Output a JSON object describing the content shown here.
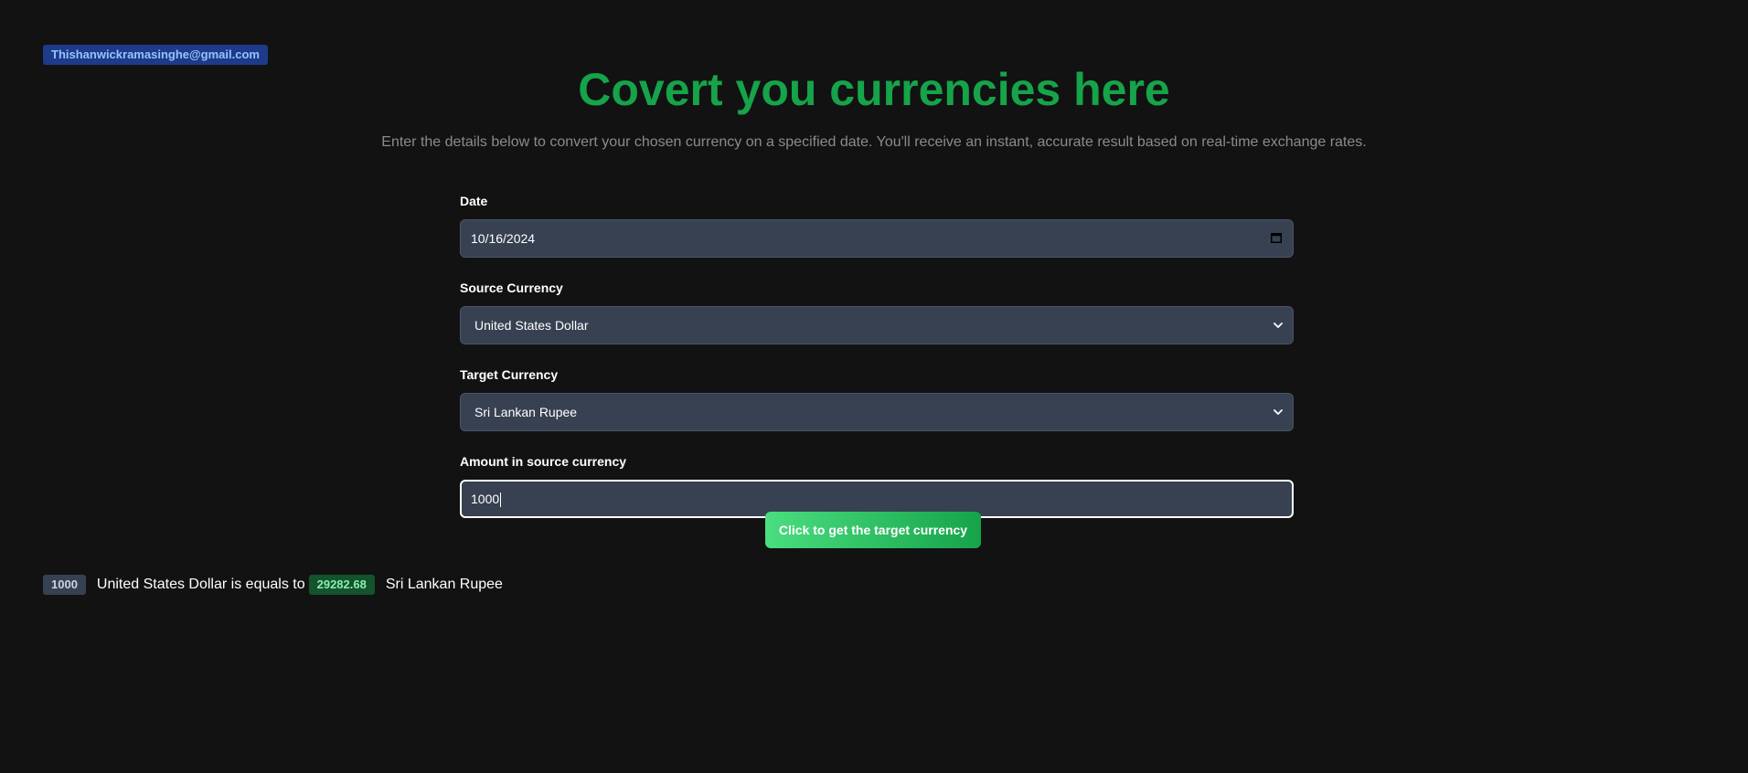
{
  "user": {
    "email": "Thishanwickramasinghe@gmail.com"
  },
  "header": {
    "title": "Covert you currencies here",
    "subtitle": "Enter the details below to convert your chosen currency on a specified date. You'll receive an instant, accurate result based on real-time exchange rates."
  },
  "form": {
    "date": {
      "label": "Date",
      "value": "10/16/2024",
      "icon": "calendar-icon"
    },
    "source_currency": {
      "label": "Source Currency",
      "selected": "United States Dollar",
      "icon": "chevron-down-icon"
    },
    "target_currency": {
      "label": "Target Currency",
      "selected": "Sri Lankan Rupee",
      "icon": "chevron-down-icon"
    },
    "amount": {
      "label": "Amount in source currency",
      "value": "1000"
    },
    "submit_label": "Click to get the target currency"
  },
  "result": {
    "amount": "1000",
    "source_currency": "United States Dollar",
    "connector": "is equals to",
    "converted_amount": "29282.68",
    "target_currency": "Sri Lankan Rupee"
  },
  "colors": {
    "background": "#121212",
    "accent": "#16a34a",
    "field_background": "#374151",
    "email_badge": "#1e3a8a",
    "result_badge": "#14532d"
  }
}
